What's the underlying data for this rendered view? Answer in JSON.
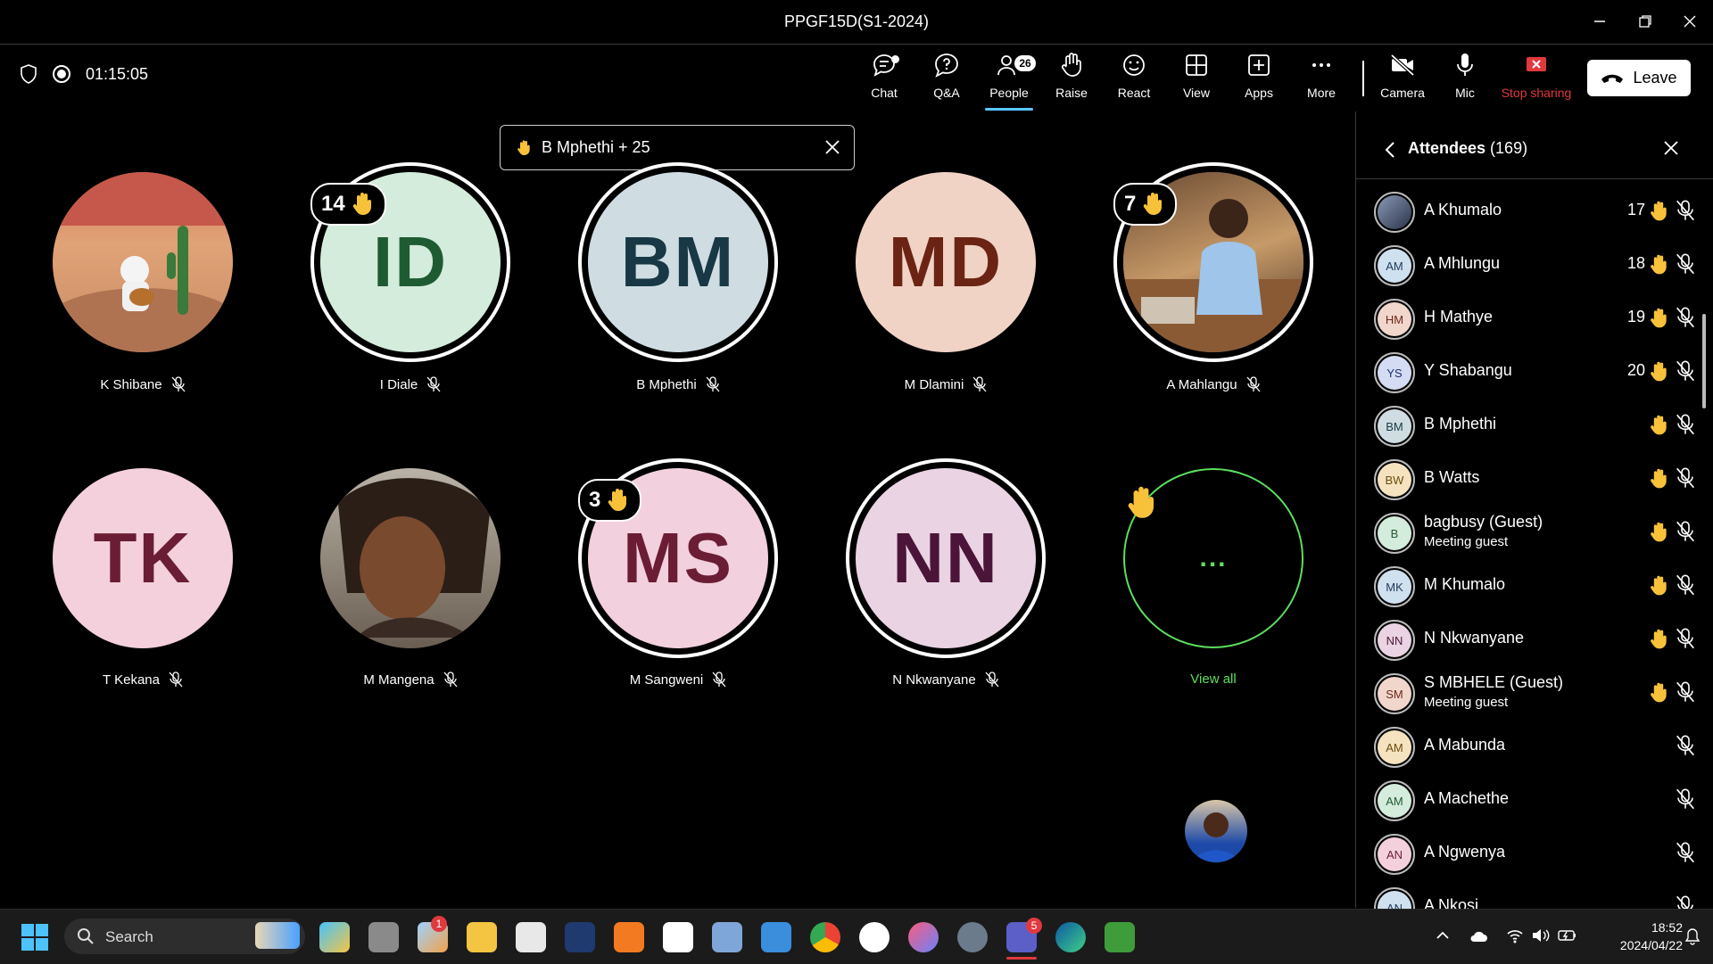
{
  "window": {
    "title": "PPGF15D(S1-2024)"
  },
  "meeting": {
    "timer": "01:15:05"
  },
  "toolbar": {
    "chat": "Chat",
    "qa": "Q&A",
    "people": "People",
    "people_count": "26",
    "raise": "Raise",
    "react": "React",
    "view": "View",
    "apps": "Apps",
    "more": "More",
    "camera": "Camera",
    "mic": "Mic",
    "stop_sharing": "Stop sharing",
    "leave": "Leave"
  },
  "toast": {
    "text": "B Mphethi + 25"
  },
  "tiles": [
    {
      "name": "K Shibane",
      "initials": "",
      "photo": "astronaut-photo"
    },
    {
      "name": "I Diale",
      "initials": "ID",
      "hand_count": "14",
      "bg": "#d4ecdc",
      "fg": "#1f5b32"
    },
    {
      "name": "B Mphethi",
      "initials": "BM",
      "bg": "#cfdde3",
      "fg": "#173844"
    },
    {
      "name": "M Dlamini",
      "initials": "MD",
      "bg": "#f1d3c6",
      "fg": "#6b2413"
    },
    {
      "name": "A Mahlangu",
      "initials": "",
      "hand_count": "7",
      "photo": "woman-photo"
    },
    {
      "name": "T Kekana",
      "initials": "TK",
      "bg": "#f3d0dc",
      "fg": "#6a1d34"
    },
    {
      "name": "M Mangena",
      "initials": "",
      "photo": "selfie-photo"
    },
    {
      "name": "M Sangweni",
      "initials": "MS",
      "hand_count": "3",
      "bg": "#f2d0dd",
      "fg": "#6a1d34"
    },
    {
      "name": "N Nkwanyane",
      "initials": "NN",
      "bg": "#ead3e3",
      "fg": "#4a1538"
    },
    {
      "name": "View all",
      "initials": "..."
    }
  ],
  "panel": {
    "title": "Attendees",
    "count": "(169)",
    "attendees": [
      {
        "name": "A Khumalo",
        "initials": "",
        "number": "17",
        "hand": true
      },
      {
        "name": "A Mhlungu",
        "initials": "AM",
        "number": "18",
        "hand": true,
        "bg": "#cfe0ef",
        "fg": "#1d3b5a"
      },
      {
        "name": "H Mathye",
        "initials": "HM",
        "number": "19",
        "hand": true,
        "bg": "#f1d6cb",
        "fg": "#6b2a17"
      },
      {
        "name": "Y Shabangu",
        "initials": "YS",
        "number": "20",
        "hand": true,
        "bg": "#d3dcf2",
        "fg": "#1d2f6a"
      },
      {
        "name": "B Mphethi",
        "initials": "BM",
        "number": "",
        "hand": true,
        "bg": "#cfdde3",
        "fg": "#173844"
      },
      {
        "name": "B Watts",
        "initials": "BW",
        "number": "",
        "hand": true,
        "bg": "#f5e3c0",
        "fg": "#6b4a10"
      },
      {
        "name": "bagbusy (Guest)",
        "sub": "Meeting guest",
        "initials": "B",
        "number": "",
        "hand": true,
        "bg": "#d4ecdc",
        "fg": "#1f5b32"
      },
      {
        "name": "M Khumalo",
        "initials": "MK",
        "number": "",
        "hand": true,
        "bg": "#cfe0ef",
        "fg": "#1d3b5a"
      },
      {
        "name": "N Nkwanyane",
        "initials": "NN",
        "number": "",
        "hand": true,
        "bg": "#ead3e3",
        "fg": "#4a1538"
      },
      {
        "name": "S MBHELE (Guest)",
        "sub": "Meeting guest",
        "initials": "SM",
        "number": "",
        "hand": true,
        "bg": "#f1d6cb",
        "fg": "#6b2a17"
      },
      {
        "name": "A Mabunda",
        "initials": "AM",
        "number": "",
        "hand": false,
        "bg": "#f5e3c0",
        "fg": "#6b4a10"
      },
      {
        "name": "A Machethe",
        "initials": "AM",
        "number": "",
        "hand": false,
        "bg": "#d4ecdc",
        "fg": "#1f5b32"
      },
      {
        "name": "A Ngwenya",
        "initials": "AN",
        "number": "",
        "hand": false,
        "bg": "#f3d0dc",
        "fg": "#6a1d34"
      },
      {
        "name": "A Nkosi",
        "initials": "AN",
        "number": "",
        "hand": false,
        "bg": "#cfe0ef",
        "fg": "#1d3b5a"
      }
    ]
  },
  "taskbar": {
    "search": "Search",
    "teams_badge": "5",
    "weather_badge": "1",
    "time": "18:52",
    "date": "2024/04/22"
  },
  "colors": {
    "accent": "#58c7ff",
    "hand": "#f7c23a",
    "stop": "#e0393e",
    "view_all": "#5ddf5d"
  }
}
